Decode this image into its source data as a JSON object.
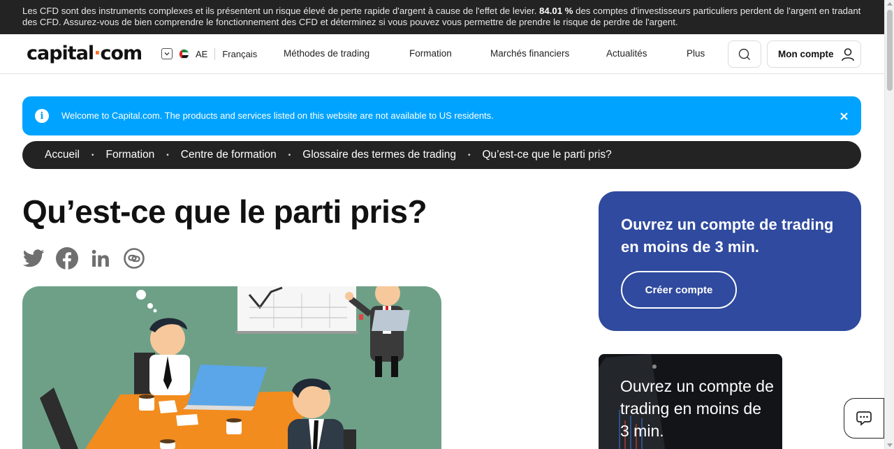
{
  "risk_warning": {
    "before": "Les CFD sont des instruments complexes et ils présentent un risque élevé de perte rapide d'argent à cause de l'effet de levier. ",
    "percent": "84.01 %",
    "after": " des comptes d'investisseurs particuliers perdent de l'argent en tradant des CFD. Assurez-vous de bien comprendre le fonctionnement des CFD et déterminez si vous pouvez vous permettre de prendre le risque de perdre de l'argent."
  },
  "header": {
    "logo_left": "capital",
    "logo_dot": "·",
    "logo_right": "com",
    "region_code": "AE",
    "language": "Français",
    "nav": [
      "Méthodes de trading",
      "Formation",
      "Marchés financiers",
      "Actualités",
      "Plus"
    ],
    "account_label": "Mon compte"
  },
  "notice": {
    "info_glyph": "i",
    "message": "Welcome to Capital.com. The products and services listed on this website are not available to US residents.",
    "close_glyph": "✕"
  },
  "breadcrumb": [
    "Accueil",
    "Formation",
    "Centre de formation",
    "Glossaire des termes de trading",
    "Qu’est-ce que le parti pris?"
  ],
  "breadcrumb_separator": "•",
  "article": {
    "title": "Qu’est-ce que le parti pris?",
    "share_icons": [
      "twitter-icon",
      "facebook-icon",
      "linkedin-icon",
      "copy-link-icon"
    ]
  },
  "sidebar": {
    "cta_title": "Ouvrez un compte de trading en moins de 3 min.",
    "cta_button": "Créer compte",
    "promo_title": "Ouvrez un compte de trading en moins de 3 min."
  },
  "colors": {
    "risk_bar": "#232323",
    "notice": "#00a3ff",
    "breadcrumb": "#232323",
    "cta_card": "#2f4a9e",
    "brand_dot": "#ff6f2c",
    "hero_bg": "#6ea088"
  }
}
